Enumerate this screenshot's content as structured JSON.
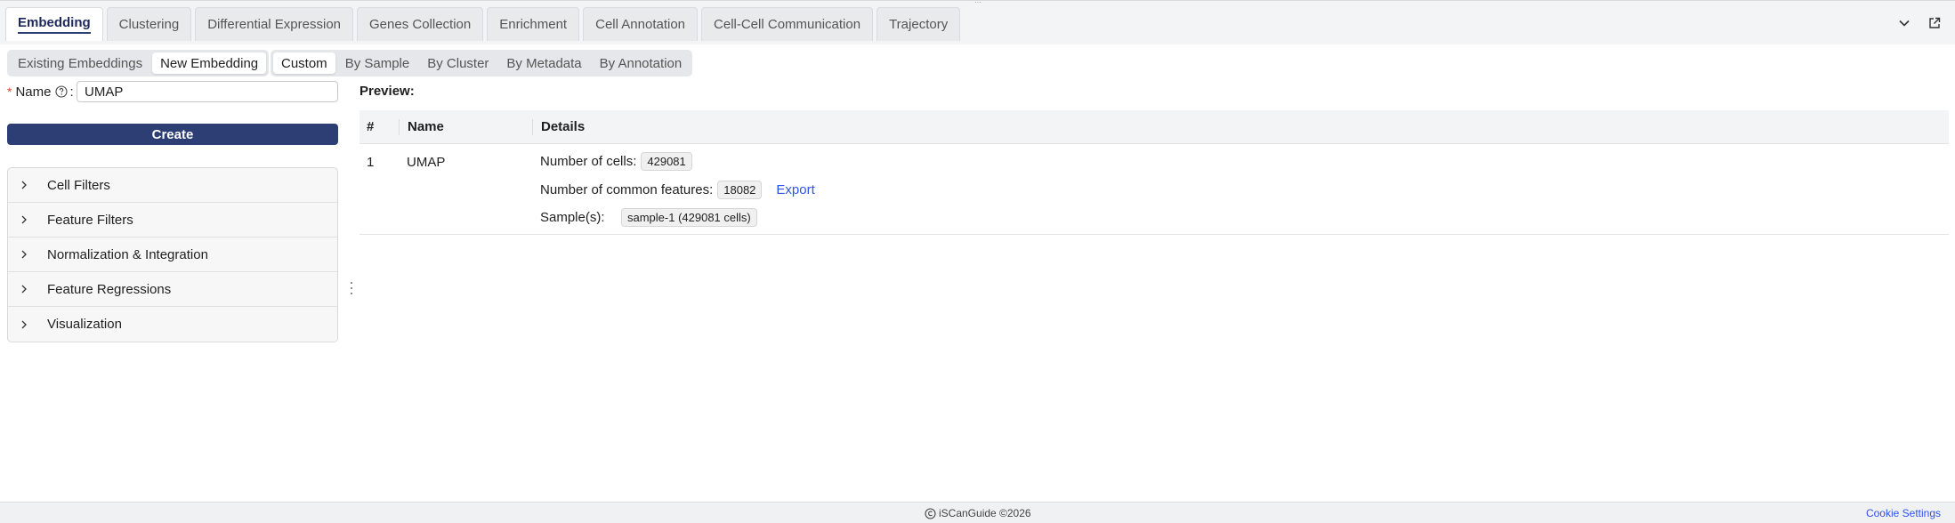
{
  "tabs": [
    {
      "label": "Embedding",
      "active": true
    },
    {
      "label": "Clustering"
    },
    {
      "label": "Differential Expression"
    },
    {
      "label": "Genes Collection"
    },
    {
      "label": "Enrichment"
    },
    {
      "label": "Cell Annotation"
    },
    {
      "label": "Cell-Cell Communication"
    },
    {
      "label": "Trajectory"
    }
  ],
  "icons": {
    "collapse": "chevron-down-icon",
    "popout": "external-link-icon",
    "help": "question-circle-icon",
    "expand": "chevron-right-icon",
    "footer": "logo-icon"
  },
  "mode_toggle": {
    "options": [
      "Existing Embeddings",
      "New Embedding"
    ],
    "selected": "New Embedding"
  },
  "source_toggle": {
    "options": [
      "Custom",
      "By Sample",
      "By Cluster",
      "By Metadata",
      "By Annotation"
    ],
    "selected": "Custom"
  },
  "form": {
    "required_mark": "*",
    "name_label": "Name",
    "colon": ":",
    "name_value": "UMAP",
    "create_label": "Create"
  },
  "accordion": [
    "Cell Filters",
    "Feature Filters",
    "Normalization & Integration",
    "Feature Regressions",
    "Visualization"
  ],
  "preview": {
    "title": "Preview:",
    "columns": [
      "#",
      "Name",
      "Details"
    ],
    "rows": [
      {
        "num": "1",
        "name": "UMAP",
        "cells_label": "Number of cells:",
        "cells_value": "429081",
        "features_label": "Number of common features:",
        "features_value": "18082",
        "export_label": "Export",
        "samples_label": "Sample(s):",
        "samples_value": "sample-1 (429081 cells)"
      }
    ]
  },
  "footer": {
    "copyright": "iSCanGuide ©2026",
    "cookie_label": "Cookie Settings"
  },
  "colors": {
    "primary": "#2c3e74",
    "link": "#2f54eb",
    "required": "#e0452e"
  }
}
